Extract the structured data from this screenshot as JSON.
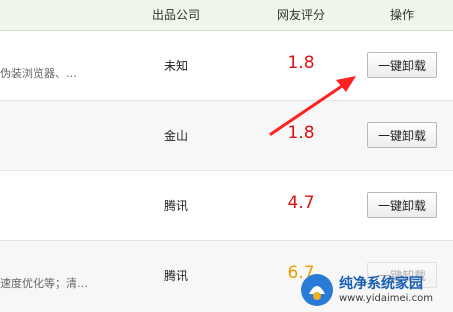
{
  "header": {
    "company_label": "出品公司",
    "score_label": "网友评分",
    "action_label": "操作"
  },
  "rows": [
    {
      "description": "伪装浏览器、…",
      "company": "未知",
      "score": "1.8",
      "score_color": "#e01010",
      "action": "一键卸载"
    },
    {
      "description": "",
      "company": "金山",
      "score": "1.8",
      "score_color": "#e01010",
      "action": "一键卸载"
    },
    {
      "description": "",
      "company": "腾讯",
      "score": "4.7",
      "score_color": "#e01010",
      "action": "一键卸载"
    },
    {
      "description": "速度优化等；清…",
      "company": "腾讯",
      "score": "6.7",
      "score_color": "#e8a000",
      "action": "一键卸载"
    }
  ],
  "annotation": {
    "type": "arrow",
    "color": "#ff2020"
  },
  "watermark": {
    "title": "纯净系统家园",
    "url": "www.yidaimei.com"
  }
}
